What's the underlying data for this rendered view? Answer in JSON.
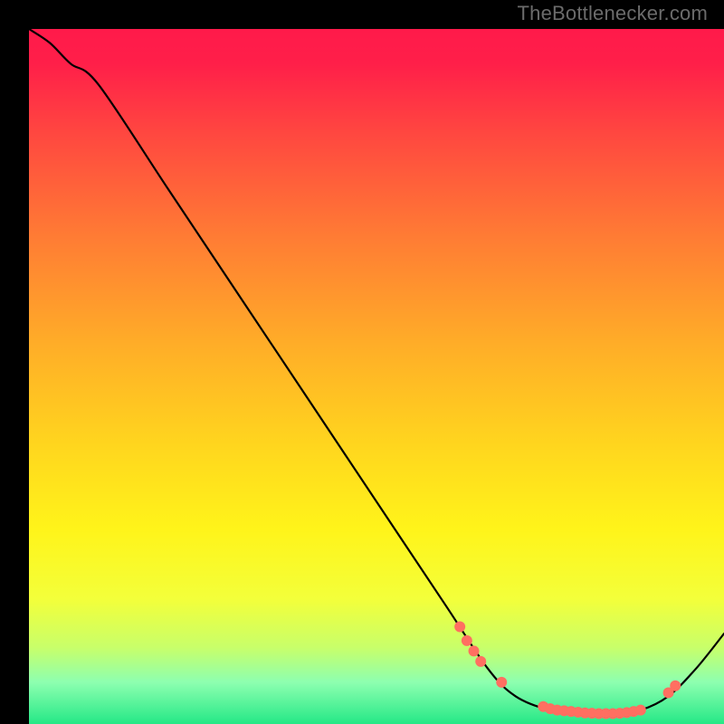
{
  "watermark": "TheBottlenecker.com",
  "chart_data": {
    "type": "line",
    "title": "",
    "xlabel": "",
    "ylabel": "",
    "xlim": [
      0,
      100
    ],
    "ylim": [
      0,
      100
    ],
    "background_gradient_stops": [
      {
        "pos": 0.0,
        "color": "#ff1a4a"
      },
      {
        "pos": 0.05,
        "color": "#ff1f49"
      },
      {
        "pos": 0.15,
        "color": "#ff4740"
      },
      {
        "pos": 0.3,
        "color": "#ff7c34"
      },
      {
        "pos": 0.45,
        "color": "#ffac28"
      },
      {
        "pos": 0.6,
        "color": "#ffd61e"
      },
      {
        "pos": 0.72,
        "color": "#fff41a"
      },
      {
        "pos": 0.82,
        "color": "#f3ff3a"
      },
      {
        "pos": 0.89,
        "color": "#c8ff6a"
      },
      {
        "pos": 0.94,
        "color": "#8dffb0"
      },
      {
        "pos": 1.0,
        "color": "#25e886"
      }
    ],
    "series": [
      {
        "name": "bottleneck-curve",
        "stroke": "#000000",
        "stroke_width": 2.2,
        "x": [
          0,
          3,
          6,
          10,
          20,
          30,
          40,
          50,
          60,
          66,
          70,
          75,
          80,
          84,
          88,
          92,
          96,
          100
        ],
        "y": [
          100,
          98,
          95,
          92,
          77,
          62,
          47,
          32,
          17,
          8,
          4,
          2,
          1.5,
          1.5,
          2,
          4,
          8,
          13
        ]
      }
    ],
    "markers": {
      "name": "highlight-points",
      "color": "#ff6f61",
      "stroke": "#ff6f61",
      "r": 5.5,
      "points": [
        {
          "x": 62,
          "y": 14
        },
        {
          "x": 63,
          "y": 12
        },
        {
          "x": 64,
          "y": 10.5
        },
        {
          "x": 65,
          "y": 9
        },
        {
          "x": 68,
          "y": 6
        },
        {
          "x": 74,
          "y": 2.5
        },
        {
          "x": 75,
          "y": 2.2
        },
        {
          "x": 76,
          "y": 2.0
        },
        {
          "x": 77,
          "y": 1.9
        },
        {
          "x": 78,
          "y": 1.8
        },
        {
          "x": 79,
          "y": 1.7
        },
        {
          "x": 80,
          "y": 1.6
        },
        {
          "x": 81,
          "y": 1.55
        },
        {
          "x": 82,
          "y": 1.5
        },
        {
          "x": 83,
          "y": 1.5
        },
        {
          "x": 84,
          "y": 1.5
        },
        {
          "x": 85,
          "y": 1.55
        },
        {
          "x": 86,
          "y": 1.65
        },
        {
          "x": 87,
          "y": 1.8
        },
        {
          "x": 88,
          "y": 2.0
        },
        {
          "x": 92,
          "y": 4.5
        },
        {
          "x": 93,
          "y": 5.5
        }
      ]
    }
  }
}
